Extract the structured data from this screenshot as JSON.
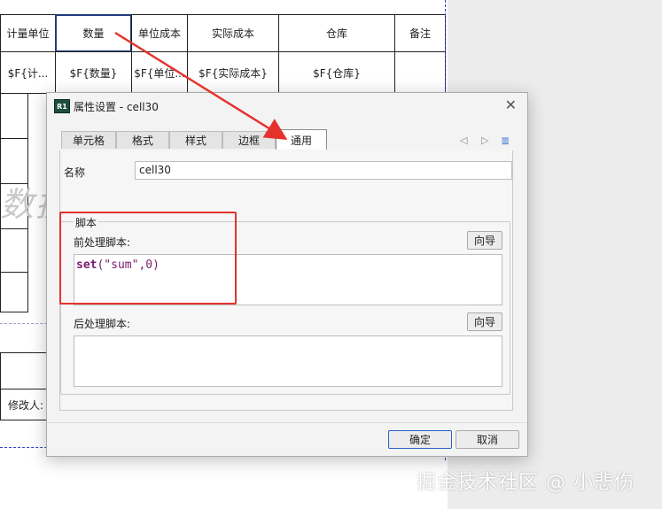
{
  "sheet": {
    "headers": [
      "计量单位",
      "数量",
      "单位成本",
      "实际成本",
      "仓库",
      "备注"
    ],
    "row1": [
      "$F{计...",
      "$F{数量}",
      "$F{单位...",
      "$F{实际成本}",
      "$F{仓库}",
      ""
    ],
    "background_text": "数据",
    "modifier_label": "修改人:"
  },
  "dialog": {
    "title": "属性设置 - cell30",
    "app_icon": "R1",
    "tabs": [
      "单元格",
      "格式",
      "样式",
      "边框",
      "通用"
    ],
    "active_tab": "通用",
    "name_label": "名称",
    "name_value": "cell30",
    "script_group_label": "脚本",
    "pre_script_label": "前处理脚本:",
    "pre_script_code_kw": "set",
    "pre_script_code_rest": "(\"sum\",0)",
    "post_script_label": "后处理脚本:",
    "wizard_label": "向导",
    "ok_label": "确定",
    "cancel_label": "取消"
  },
  "icons": {
    "close": "close-icon",
    "prev": "tab-prev-icon",
    "next": "tab-next-icon",
    "list": "tab-list-icon"
  },
  "colors": {
    "annotation_red": "#e5322d",
    "selected_cell_border": "#1f3a7a",
    "page_break_blue": "#3340c8"
  },
  "watermark": "掘金技术社区 @ 小悲伤"
}
